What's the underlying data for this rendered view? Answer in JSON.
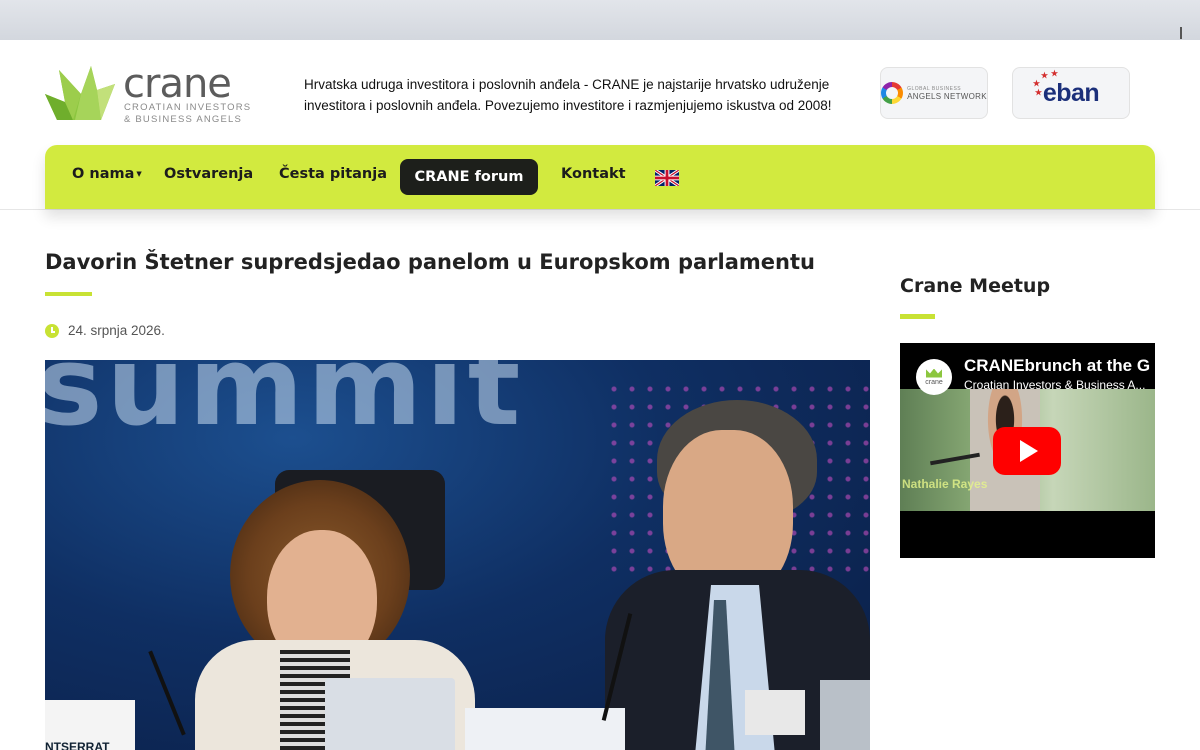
{
  "site": {
    "logo_word": "crane",
    "logo_sub_line1": "CROATIAN INVESTORS",
    "logo_sub_line2": "& BUSINESS ANGELS",
    "intro": "Hrvatska udruga investitora i poslovnih anđela - CRANE je najstarije hrvatsko udruženje investitora i poslovnih anđela. Povezujemo investitore i razmjenjujemo iskustva od 2008!"
  },
  "partners": {
    "gan_small": "GLOBAL BUSINESS",
    "gan_big": "ANGELS NETWORK",
    "eban": "eban"
  },
  "nav": {
    "about": "O nama",
    "achievements": "Ostvarenja",
    "faq": "Česta pitanja",
    "forum": "CRANE forum",
    "contact": "Kontakt",
    "language_icon": "uk-flag-icon"
  },
  "article": {
    "title": "Davorin Štetner supredsjedao panelom u Europskom parlamentu",
    "date": "24. srpnja 2026.",
    "photo_backdrop_text": "summit",
    "photo_nameplate_left": "NTSERRAT"
  },
  "sidebar": {
    "title": "Crane Meetup",
    "video": {
      "channel_avatar_text": "crane",
      "title": "CRANEbrunch at the G",
      "channel": "Croatian Investors & Business A...",
      "caption": "Nathalie Rayes"
    }
  },
  "colors": {
    "accent_lime": "#d2ea3f",
    "forum_button_bg": "#1d1f1b",
    "youtube_red": "#ff0000"
  }
}
